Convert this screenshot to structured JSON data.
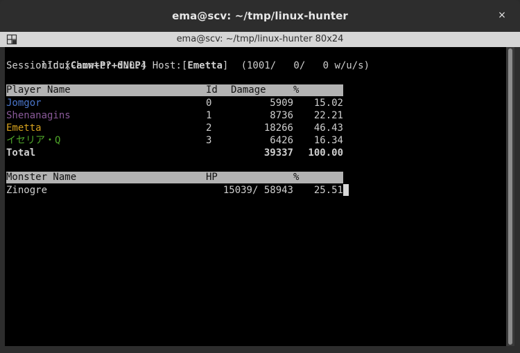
{
  "window": {
    "title": "ema@scv: ~/tmp/linux-hunter",
    "close_glyph": "×"
  },
  "tab": {
    "title": "ema@scv: ~/tmp/linux-hunter 80x24"
  },
  "app": {
    "name_version": "linux-hunter 0.0.4",
    "stats": "(1001/   0/   0 w/u/s)",
    "session_label": "SessionId:[",
    "session_id": "Camw+P?+dNLP",
    "host_label": "] Host:[",
    "host": "Emetta",
    "host_end": "]"
  },
  "players_table": {
    "headers": {
      "name": "Player Name",
      "id": "Id",
      "damage": "Damage",
      "percent": "%"
    },
    "rows": [
      {
        "name": "Jomgor",
        "id": "0",
        "damage": "5909",
        "percent": "15.02",
        "color": "#4a76cc"
      },
      {
        "name": "Shenanagins",
        "id": "1",
        "damage": "8736",
        "percent": "22.21",
        "color": "#8a5a9a"
      },
      {
        "name": "Emetta",
        "id": "2",
        "damage": "18266",
        "percent": "46.43",
        "color": "#d6a21e"
      },
      {
        "name": "イセリア・Q",
        "id": "3",
        "damage": "6426",
        "percent": "16.34",
        "color": "#4fa62a"
      }
    ],
    "total": {
      "name": "Total",
      "damage": "39337",
      "percent": "100.00"
    }
  },
  "monsters_table": {
    "headers": {
      "name": "Monster Name",
      "hp": "HP",
      "percent": "%"
    },
    "rows": [
      {
        "name": "Zinogre",
        "hp": "15039/ 58943",
        "percent": "25.51"
      }
    ]
  },
  "icons": {
    "menu": "terminal-menu-icon",
    "close": "close-icon"
  }
}
